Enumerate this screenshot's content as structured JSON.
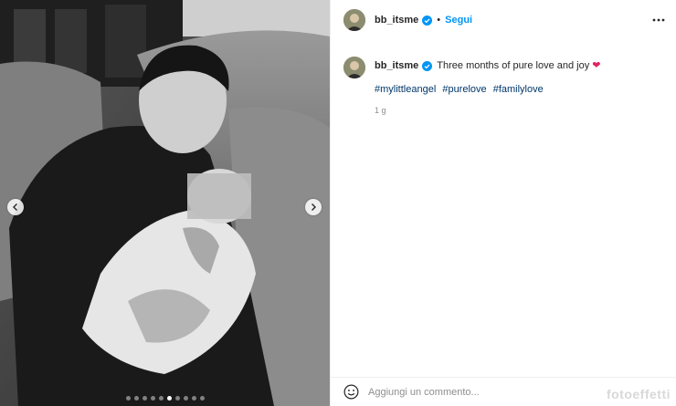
{
  "post": {
    "username": "bb_itsme",
    "follow_label": "Segui",
    "separator": "•",
    "caption": "Three months of pure love and joy",
    "heart": "❤",
    "hashtags": [
      "#mylittleangel",
      "#purelove",
      "#familylove"
    ],
    "time_ago": "1 g",
    "comment_placeholder": "Aggiungi un commento...",
    "carousel": {
      "total": 10,
      "active": 6
    }
  },
  "icons": {
    "verified": "verified-badge-icon",
    "more": "more-options-icon",
    "emoji": "emoji-icon",
    "prev": "chevron-left-icon",
    "next": "chevron-right-icon"
  },
  "colors": {
    "link_blue": "#0095f6",
    "hashtag": "#00376b",
    "muted": "#8e8e8e",
    "heart": "#e0245e"
  },
  "watermark": "fotoeffetti"
}
